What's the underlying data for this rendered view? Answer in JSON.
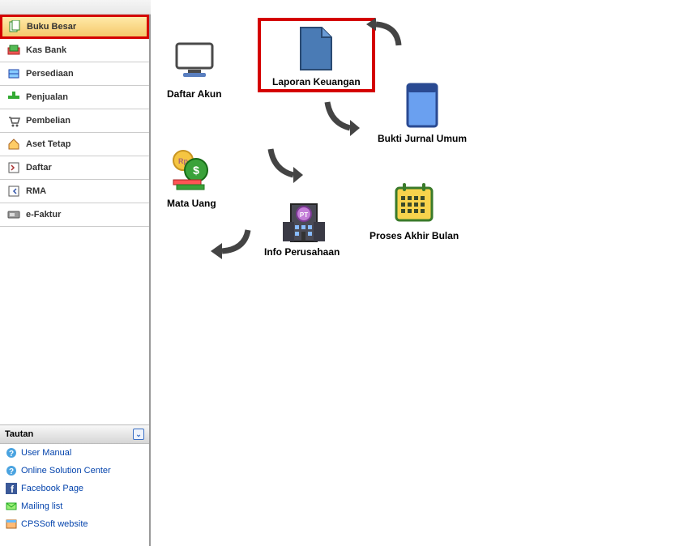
{
  "sidebar": {
    "nav": [
      {
        "label": "Buku Besar",
        "icon": "ledger-icon",
        "selected": true
      },
      {
        "label": "Kas Bank",
        "icon": "cashbank-icon",
        "selected": false
      },
      {
        "label": "Persediaan",
        "icon": "inventory-icon",
        "selected": false
      },
      {
        "label": "Penjualan",
        "icon": "sales-icon",
        "selected": false
      },
      {
        "label": "Pembelian",
        "icon": "purchase-icon",
        "selected": false
      },
      {
        "label": "Aset Tetap",
        "icon": "fixedasset-icon",
        "selected": false
      },
      {
        "label": "Daftar",
        "icon": "list-icon",
        "selected": false
      },
      {
        "label": "RMA",
        "icon": "rma-icon",
        "selected": false
      },
      {
        "label": "e-Faktur",
        "icon": "efaktur-icon",
        "selected": false
      }
    ],
    "links_header": "Tautan",
    "links": [
      {
        "label": "User Manual",
        "icon": "help-icon"
      },
      {
        "label": "Online Solution Center",
        "icon": "help-icon"
      },
      {
        "label": "Facebook Page",
        "icon": "facebook-icon"
      },
      {
        "label": "Mailing list",
        "icon": "mailing-icon"
      },
      {
        "label": "CPSSoft website",
        "icon": "website-icon"
      }
    ]
  },
  "diagram": {
    "daftar_akun": "Daftar Akun",
    "laporan_keuangan": "Laporan Keuangan",
    "bukti_jurnal_umum": "Bukti Jurnal Umum",
    "mata_uang": "Mata Uang",
    "info_perusahaan": "Info Perusahaan",
    "proses_akhir_bulan": "Proses Akhir Bulan"
  }
}
